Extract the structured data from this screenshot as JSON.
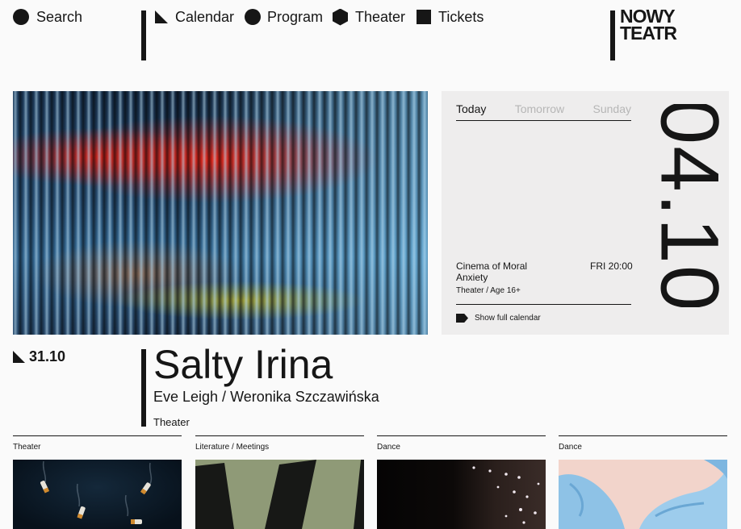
{
  "nav": {
    "search": "Search",
    "calendar": "Calendar",
    "program": "Program",
    "theater": "Theater",
    "tickets": "Tickets"
  },
  "logo": {
    "line1": "NOWY",
    "line2": "TEATR"
  },
  "calendar": {
    "tabs": [
      "Today",
      "Tomorrow",
      "Sunday"
    ],
    "active_tab": "Today",
    "event": {
      "title": "Cinema of Moral Anxiety",
      "time": "FRI 20:00",
      "category": "Theater / Age 16+"
    },
    "show_full": "Show full calendar",
    "big_date": "04.10"
  },
  "featured": {
    "date": "31.10",
    "title": "Salty Irina",
    "authors": "Eve Leigh / Weronika Szczawińska",
    "category": "Theater"
  },
  "cards": [
    {
      "category": "Theater"
    },
    {
      "category": "Literature / Meetings"
    },
    {
      "category": "Dance"
    },
    {
      "category": "Dance"
    }
  ],
  "colors": {
    "text": "#161616",
    "panel": "#eeeded",
    "muted": "#b6b6b6",
    "background": "#fafafa"
  }
}
